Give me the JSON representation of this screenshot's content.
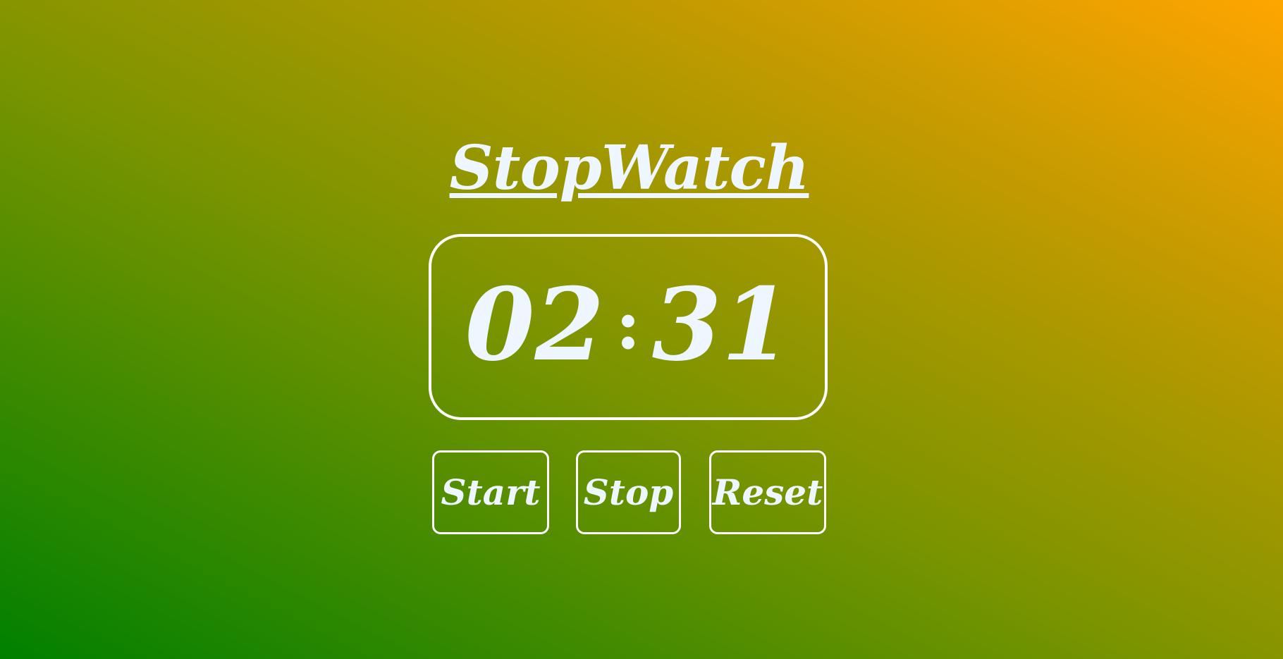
{
  "app": {
    "title": "StopWatch"
  },
  "timer": {
    "minutes": "02",
    "separator": ":",
    "seconds": "31"
  },
  "controls": {
    "start_label": "Start",
    "stop_label": "Stop",
    "reset_label": "Reset"
  },
  "colors": {
    "gradient_start": "#008000",
    "gradient_end": "#ffa500",
    "text": "#eef6ff",
    "border": "#ffffff"
  }
}
